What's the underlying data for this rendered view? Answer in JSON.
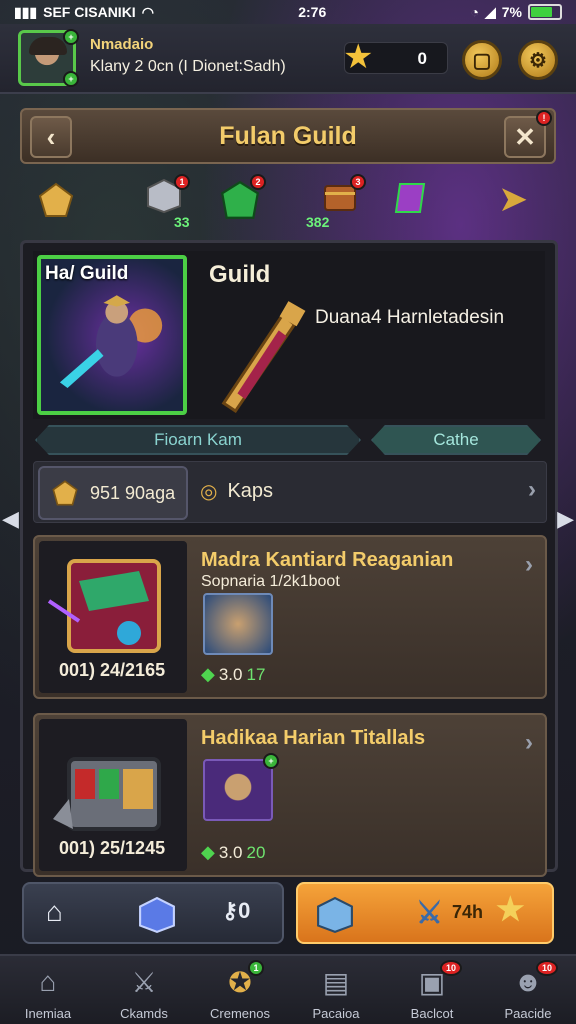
{
  "status_bar": {
    "left_text": "SEF CISANIKI",
    "time": "2:76",
    "battery_text": "7%",
    "battery_level": 0.75
  },
  "player": {
    "name": "Nmadaio",
    "subtitle": "Klany 2 0cn (I Dionet:Sadh)",
    "stars": "0"
  },
  "guild_header": {
    "title": "Fulan Guild",
    "back_icon": "chevron-left-icon",
    "close_icon": "close-icon",
    "close_badge": "!"
  },
  "resources": [
    {
      "icon": "gold-pentagon-icon",
      "count": "",
      "badge": ""
    },
    {
      "icon": "silver-cube-icon",
      "count": "33",
      "badge": "1"
    },
    {
      "icon": "green-gem-icon",
      "count": "",
      "badge": "2"
    },
    {
      "icon": "chest-icon",
      "count": "382",
      "badge": "3"
    },
    {
      "icon": "purple-crystal-icon",
      "count": "",
      "badge": ""
    }
  ],
  "featured": {
    "card_label": "Ha/ Guild",
    "title": "Guild",
    "description": "Duana4 Harnletadesin"
  },
  "tabs": [
    {
      "label": "Fioarn Kam"
    },
    {
      "label": "Cathe"
    }
  ],
  "currency": {
    "coins": "951 90aga",
    "keys": "Kaps"
  },
  "items": [
    {
      "title": "Madra Kantiard Reaganian",
      "subtitle": "Sopnaria 1/2k1boot",
      "price": "001) 24/2165",
      "stat_value": "3.0",
      "stat_bonus": "17"
    },
    {
      "title": "Hadikaa Harian Titallals",
      "subtitle": "",
      "price": "001) 25/1245",
      "stat_value": "3.0",
      "stat_bonus": "20"
    }
  ],
  "action_bar": {
    "left_count": "0",
    "right_label": "74h"
  },
  "bottom_nav": [
    {
      "label": "Inemiaa",
      "icon": "home-icon",
      "badge": ""
    },
    {
      "label": "Ckamds",
      "icon": "sword-icon",
      "badge": ""
    },
    {
      "label": "Cremenos",
      "icon": "guild-emblem-icon",
      "badge": "1"
    },
    {
      "label": "Pacaioa",
      "icon": "book-icon",
      "badge": ""
    },
    {
      "label": "Baclcot",
      "icon": "chat-icon",
      "badge": "10"
    },
    {
      "label": "Paacide",
      "icon": "people-icon",
      "badge": "10"
    }
  ],
  "colors": {
    "accent_gold": "#f3cc6a",
    "green": "#4ccf45",
    "orange": "#f5a33a",
    "panel": "#1c1c22"
  }
}
